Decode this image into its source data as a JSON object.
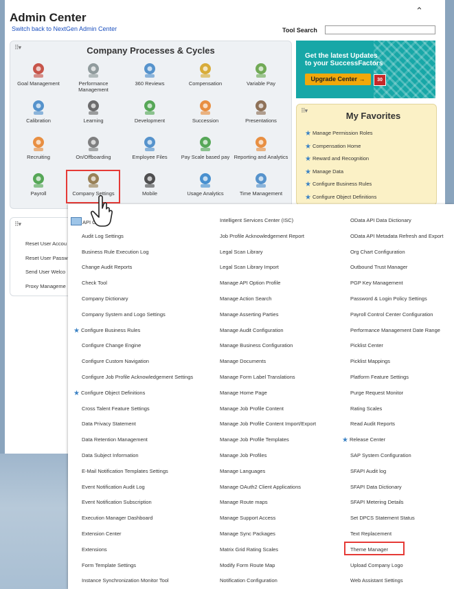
{
  "header": {
    "title": "Admin Center",
    "switch_link": "Switch back to NextGen Admin Center",
    "tool_search_label": "Tool Search",
    "tool_search_value": ""
  },
  "processes": {
    "title": "Company Processes & Cycles",
    "tiles": [
      {
        "label": "Goal Management",
        "icon": "target-icon"
      },
      {
        "label": "Performance Management",
        "icon": "notepad-icon"
      },
      {
        "label": "360 Reviews",
        "icon": "people-circle-icon"
      },
      {
        "label": "Compensation",
        "icon": "coins-icon"
      },
      {
        "label": "Variable Pay",
        "icon": "money-chart-icon"
      },
      {
        "label": "Calibration",
        "icon": "calibration-icon"
      },
      {
        "label": "Learning",
        "icon": "graduation-cap-icon"
      },
      {
        "label": "Development",
        "icon": "growth-chart-icon"
      },
      {
        "label": "Succession",
        "icon": "succession-icon"
      },
      {
        "label": "Presentations",
        "icon": "presentation-board-icon"
      },
      {
        "label": "Recruiting",
        "icon": "add-person-icon"
      },
      {
        "label": "On/Offboarding",
        "icon": "onboarding-icon"
      },
      {
        "label": "Employee Files",
        "icon": "employee-file-icon"
      },
      {
        "label": "Pay Scale based pay",
        "icon": "pay-scale-icon"
      },
      {
        "label": "Reporting and Analytics",
        "icon": "bar-chart-icon"
      },
      {
        "label": "Payroll",
        "icon": "payroll-icon"
      },
      {
        "label": "Company Settings",
        "icon": "tools-icon"
      },
      {
        "label": "Mobile",
        "icon": "mobile-icon"
      },
      {
        "label": "Usage Analytics",
        "icon": "monitor-chart-icon"
      },
      {
        "label": "Time Management",
        "icon": "time-person-icon"
      }
    ]
  },
  "promo": {
    "text_line1": "Get the latest Updates",
    "text_line2": "to your SuccessFactors",
    "button_label": "Upgrade Center",
    "badge_count": "30"
  },
  "favorites": {
    "title": "My Favorites",
    "items": [
      "Manage Permission Roles",
      "Compensation Home",
      "Reward and Recognition",
      "Manage Data",
      "Configure Business Rules",
      "Configure Object Definitions"
    ]
  },
  "small_panel": {
    "items": [
      "Reset User Accou",
      "Reset User Passw",
      "Send User Welco",
      "Proxy Manageme"
    ]
  },
  "dropdown": {
    "col1": [
      "API C",
      "Audit Log Settings",
      "Business Rule Execution Log",
      "Change Audit Reports",
      "Check Tool",
      "Company Dictionary",
      "Company System and Logo Settings",
      "Configure Business Rules",
      "Configure Change Engine",
      "Configure Custom Navigation",
      "Configure Job Profile Acknowledgement Settings",
      "Configure Object Definitions",
      "Cross Talent Feature Settings",
      "Data Privacy Statement",
      "Data Retention Management",
      "Data Subject Information",
      "E-Mail Notification Templates Settings",
      "Event Notification Audit Log",
      "Event Notification Subscription",
      "Execution Manager Dashboard",
      "Extension Center",
      "Extensions",
      "Form Template Settings",
      "Instance Synchronization Monitor Tool"
    ],
    "col2": [
      "Intelligent Services Center (ISC)",
      "Job Profile Acknowledgement Report",
      "Legal Scan Library",
      "Legal Scan Library Import",
      "Manage API Option Profile",
      "Manage Action Search",
      "Manage Asserting Parties",
      "Manage Audit Configuration",
      "Manage Business Configuration",
      "Manage Documents",
      "Manage Form Label Translations",
      "Manage Home Page",
      "Manage Job Profile Content",
      "Manage Job Profile Content Import/Export",
      "Manage Job Profile Templates",
      "Manage Job Profiles",
      "Manage Languages",
      "Manage OAuth2 Client Applications",
      "Manage Route maps",
      "Manage Support Access",
      "Manage Sync Packages",
      "Matrix Grid Rating Scales",
      "Modify Form Route Map",
      "Notification Configuration"
    ],
    "col3": [
      "OData API Data Dictionary",
      "OData API Metadata Refresh and Export",
      "Org Chart Configuration",
      "Outbound Trust Manager",
      "PGP Key Management",
      "Password & Login Policy Settings",
      "Payroll Control Center Configuration",
      "Performance Management Date Range",
      "Picklist Center",
      "Picklist Mappings",
      "Platform Feature Settings",
      "Purge Request Monitor",
      "Rating Scales",
      "Read Audit Reports",
      "Release Center",
      "SAP System Configuration",
      "SFAPI Audit log",
      "SFAPI Data Dictionary",
      "SFAPI Metering Details",
      "Set DPCS Statement Status",
      "Text Replacement",
      "Theme Manager",
      "Upload Company Logo",
      "Web Assistant Settings"
    ],
    "starred": [
      "Configure Business Rules",
      "Configure Object Definitions",
      "Release Center"
    ]
  },
  "colors": {
    "accent_red": "#e53935",
    "link_blue": "#1a4fbf",
    "promo_teal": "#17a7a7",
    "promo_button": "#f1a80a",
    "favorites_bg": "#fbf1c6",
    "star_blue": "#3b82c4"
  }
}
